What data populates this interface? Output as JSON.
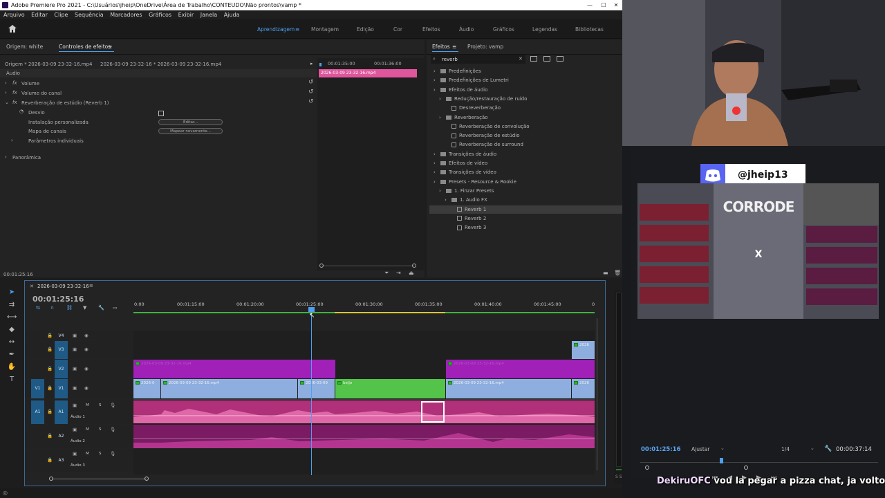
{
  "window": {
    "title": "Adobe Premiere Pro 2021 - C:\\Usuários\\jheip\\OneDrive\\Área de Trabalho\\CONTEUDO\\Não prontos\\vamp *",
    "controls": [
      "—",
      "☐",
      "✕"
    ]
  },
  "menu": [
    "Arquivo",
    "Editar",
    "Clipe",
    "Sequência",
    "Marcadores",
    "Gráficos",
    "Exibir",
    "Janela",
    "Ajuda"
  ],
  "workspaces": [
    {
      "label": "Aprendizagem",
      "active": true
    },
    {
      "label": "Montagem"
    },
    {
      "label": "Edição"
    },
    {
      "label": "Cor"
    },
    {
      "label": "Efeitos"
    },
    {
      "label": "Áudio"
    },
    {
      "label": "Gráficos"
    },
    {
      "label": "Legendas"
    },
    {
      "label": "Bibliotecas"
    }
  ],
  "effect_controls": {
    "tab_source": "Origem: white",
    "tab_active": "Controles de efeitos",
    "source_clip": "Origem * 2026-03-09 23-32-16.mp4",
    "seq_clip": "2026-03-09 23-32-16 * 2026-03-09 23-32-16.mp4",
    "section": "Áudio",
    "effects": [
      {
        "name": "Volume"
      },
      {
        "name": "Volume do canal"
      },
      {
        "name": "Reverberação de estúdio (Reverb 1)"
      }
    ],
    "params": [
      {
        "label": "Desvio"
      },
      {
        "label": "Instalação personalizada",
        "button": "Editar..."
      },
      {
        "label": "Mapa de canais",
        "button": "Mapear novamente..."
      },
      {
        "label": "Parâmetros individuais"
      }
    ],
    "panoramica": "Panorâmica",
    "mini_time_1": "00:01:35:00",
    "mini_time_2": "00:01:36:00",
    "mini_clip": "2026-03-09 23-32-16.mp4",
    "timecode": "00:01:25:16"
  },
  "effects_panel": {
    "tab_active": "Efeitos",
    "tab_project": "Projeto: vamp",
    "search": "reverb",
    "tree": [
      {
        "label": "Predefinições",
        "level": 0,
        "type": "folder"
      },
      {
        "label": "Predefinições de Lumetri",
        "level": 0,
        "type": "folder"
      },
      {
        "label": "Efeitos de áudio",
        "level": 0,
        "type": "folder"
      },
      {
        "label": "Redução/restauração de ruído",
        "level": 1,
        "type": "folder"
      },
      {
        "label": "Desreverberação",
        "level": 2,
        "type": "fx"
      },
      {
        "label": "Reverberação",
        "level": 1,
        "type": "folder"
      },
      {
        "label": "Reverberação de convolução",
        "level": 2,
        "type": "fx"
      },
      {
        "label": "Reverberação de estúdio",
        "level": 2,
        "type": "fx"
      },
      {
        "label": "Reverberação de surround",
        "level": 2,
        "type": "fx"
      },
      {
        "label": "Transições de áudio",
        "level": 0,
        "type": "folder"
      },
      {
        "label": "Efeitos de vídeo",
        "level": 0,
        "type": "folder"
      },
      {
        "label": "Transições de vídeo",
        "level": 0,
        "type": "folder"
      },
      {
        "label": "Presets - Resource & Rookie",
        "level": 0,
        "type": "folder"
      },
      {
        "label": "1. Finzar Presets",
        "level": 1,
        "type": "folder"
      },
      {
        "label": "1. Audio FX",
        "level": 2,
        "type": "folder"
      },
      {
        "label": "Reverb 1",
        "level": 3,
        "type": "fx",
        "selected": true
      },
      {
        "label": "Reverb 2",
        "level": 3,
        "type": "fx"
      },
      {
        "label": "Reverb 3",
        "level": 3,
        "type": "fx"
      }
    ]
  },
  "timeline": {
    "sequence_name": "2026-03-09 23-32-16",
    "timecode": "00:01:25:16",
    "ruler": [
      "0:00",
      "00:01:15:00",
      "00:01:20:00",
      "00:01:25:00",
      "00:01:30:00",
      "00:01:35:00",
      "00:01:40:00",
      "00:01:45:00",
      "0"
    ],
    "tracks": [
      {
        "id": "V4"
      },
      {
        "id": "V3"
      },
      {
        "id": "V2"
      },
      {
        "id": "V1",
        "src": "V1"
      },
      {
        "id": "A1",
        "src": "A1",
        "name": "Áudio 1",
        "m": "M",
        "s": "S"
      },
      {
        "id": "A2",
        "name": "Áudio 2",
        "m": "M",
        "s": "S"
      },
      {
        "id": "A3",
        "name": "Áudio 3",
        "m": "M",
        "s": "S"
      }
    ],
    "clips_v1": [
      "2026-0",
      "2026-03-09 23-32-16.mp4",
      "2026-03-09",
      "beijo",
      "2026-03-09 23-32-16.mp4",
      "2026"
    ],
    "clip_v3": "2026",
    "clip_v2": [
      "2026-03-09 23-32-16.mp4",
      "2026-03-09 23-32-16.mp4"
    ]
  },
  "program": {
    "timecode": "00:01:25:16",
    "fit": "Ajustar",
    "resolution": "1/4",
    "duration": "00:00:37:14"
  },
  "stream": {
    "discord_handle": "@jheip13",
    "game_title": "CORRODE",
    "caption_user": "DekiruOFC",
    "caption_text": "vou la pegar a pizza chat, ja volto"
  },
  "colors": {
    "accent_blue": "#4e9ff0",
    "video_clip": "#8eaee0",
    "v2_clip": "#a020b8",
    "beijo_clip": "#54c34a",
    "audio_clip": "#b0307a",
    "selected_clip": "#e0569c"
  }
}
